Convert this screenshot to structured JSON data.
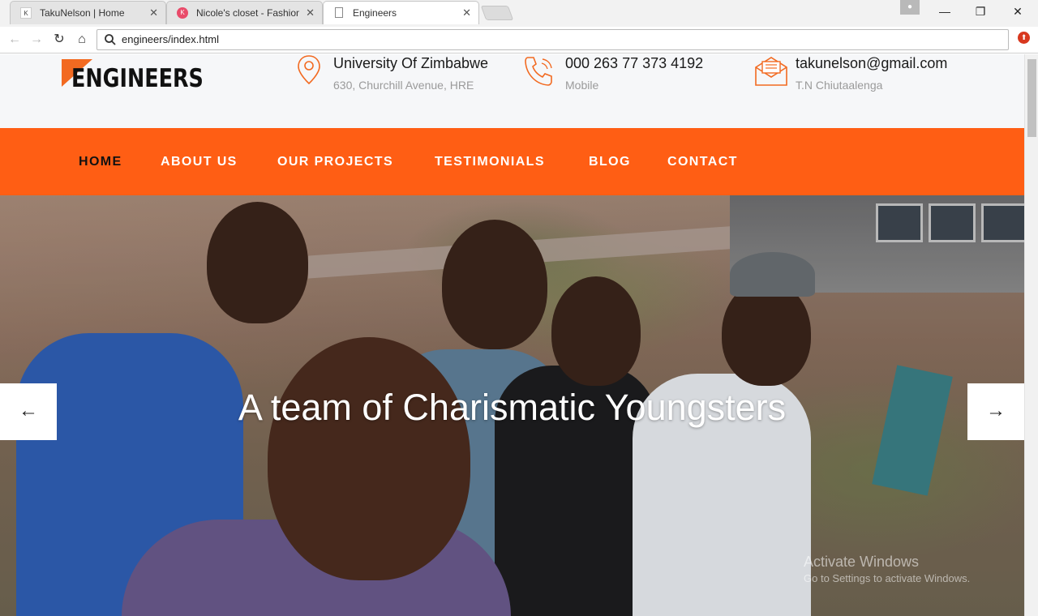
{
  "browser": {
    "tabs": [
      {
        "title": "TakuNelson | Home",
        "favicon": "K"
      },
      {
        "title": "Nicole's closet - Fashion",
        "favicon": "K"
      },
      {
        "title": "Engineers",
        "favicon": ""
      }
    ],
    "address": "engineers/index.html"
  },
  "site": {
    "logo": "ENGINEERS",
    "contacts": [
      {
        "icon": "location-pin-icon",
        "line1": "University Of Zimbabwe",
        "line2": "630, Churchill Avenue, HRE"
      },
      {
        "icon": "phone-icon",
        "line1": "000 263 77 373 4192",
        "line2": "Mobile"
      },
      {
        "icon": "envelope-icon",
        "line1": "takunelson@gmail.com",
        "line2": "T.N Chiutaalenga"
      }
    ],
    "nav": [
      "HOME",
      "ABOUT US",
      "OUR PROJECTS",
      "TESTIMONIALS",
      "BLOG",
      "CONTACT"
    ],
    "accent": "#ff5e14"
  },
  "hero": {
    "title": "A team of Charismatic Youngsters",
    "prev_symbol": "←",
    "next_symbol": "→"
  },
  "watermark": {
    "line1": "Activate Windows",
    "line2": "Go to Settings to activate Windows."
  }
}
